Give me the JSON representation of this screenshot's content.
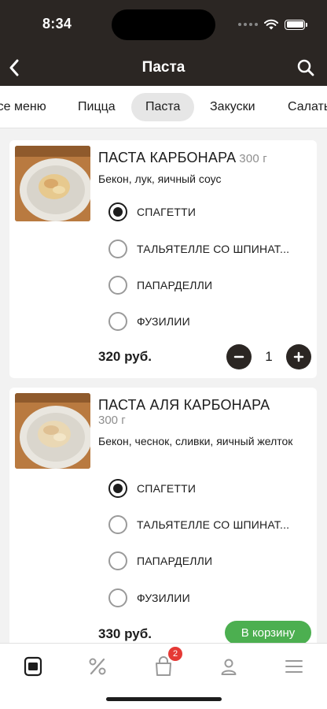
{
  "status": {
    "time": "8:34"
  },
  "nav": {
    "title": "Паста"
  },
  "tabs": [
    {
      "label": "Все меню"
    },
    {
      "label": "Пицца"
    },
    {
      "label": "Паста"
    },
    {
      "label": "Закуски"
    },
    {
      "label": "Салаты"
    }
  ],
  "products": [
    {
      "name": "ПАСТА КАРБОНАРА",
      "weight": "300 г",
      "description": "Бекон, лук, яичный соус",
      "options": [
        {
          "label": "СПАГЕТТИ",
          "selected": true
        },
        {
          "label": "ТАЛЬЯТЕЛЛЕ СО ШПИНАТ...",
          "selected": false
        },
        {
          "label": "ПАПАРДЕЛЛИ",
          "selected": false
        },
        {
          "label": "ФУЗИЛИИ",
          "selected": false
        }
      ],
      "price": "320 руб.",
      "quantity": "1"
    },
    {
      "name": "ПАСТА АЛЯ КАРБОНАРА",
      "weight": "300 г",
      "description": "Бекон, чеснок, сливки, яичный желток",
      "options": [
        {
          "label": "СПАГЕТТИ",
          "selected": true
        },
        {
          "label": "ТАЛЬЯТЕЛЛЕ СО ШПИНАТ...",
          "selected": false
        },
        {
          "label": "ПАПАРДЕЛЛИ",
          "selected": false
        },
        {
          "label": "ФУЗИЛИИ",
          "selected": false
        }
      ],
      "price": "330 руб.",
      "cart_label": "В корзину"
    }
  ],
  "tabbar": {
    "items": [
      {
        "icon": "menu-book-icon"
      },
      {
        "icon": "percent-icon"
      },
      {
        "icon": "cart-bag-icon",
        "badge": "2"
      },
      {
        "icon": "profile-icon"
      },
      {
        "icon": "hamburger-icon"
      }
    ]
  },
  "colors": {
    "header": "#2b2623",
    "accent_green": "#4caf50",
    "badge_red": "#e53935"
  }
}
